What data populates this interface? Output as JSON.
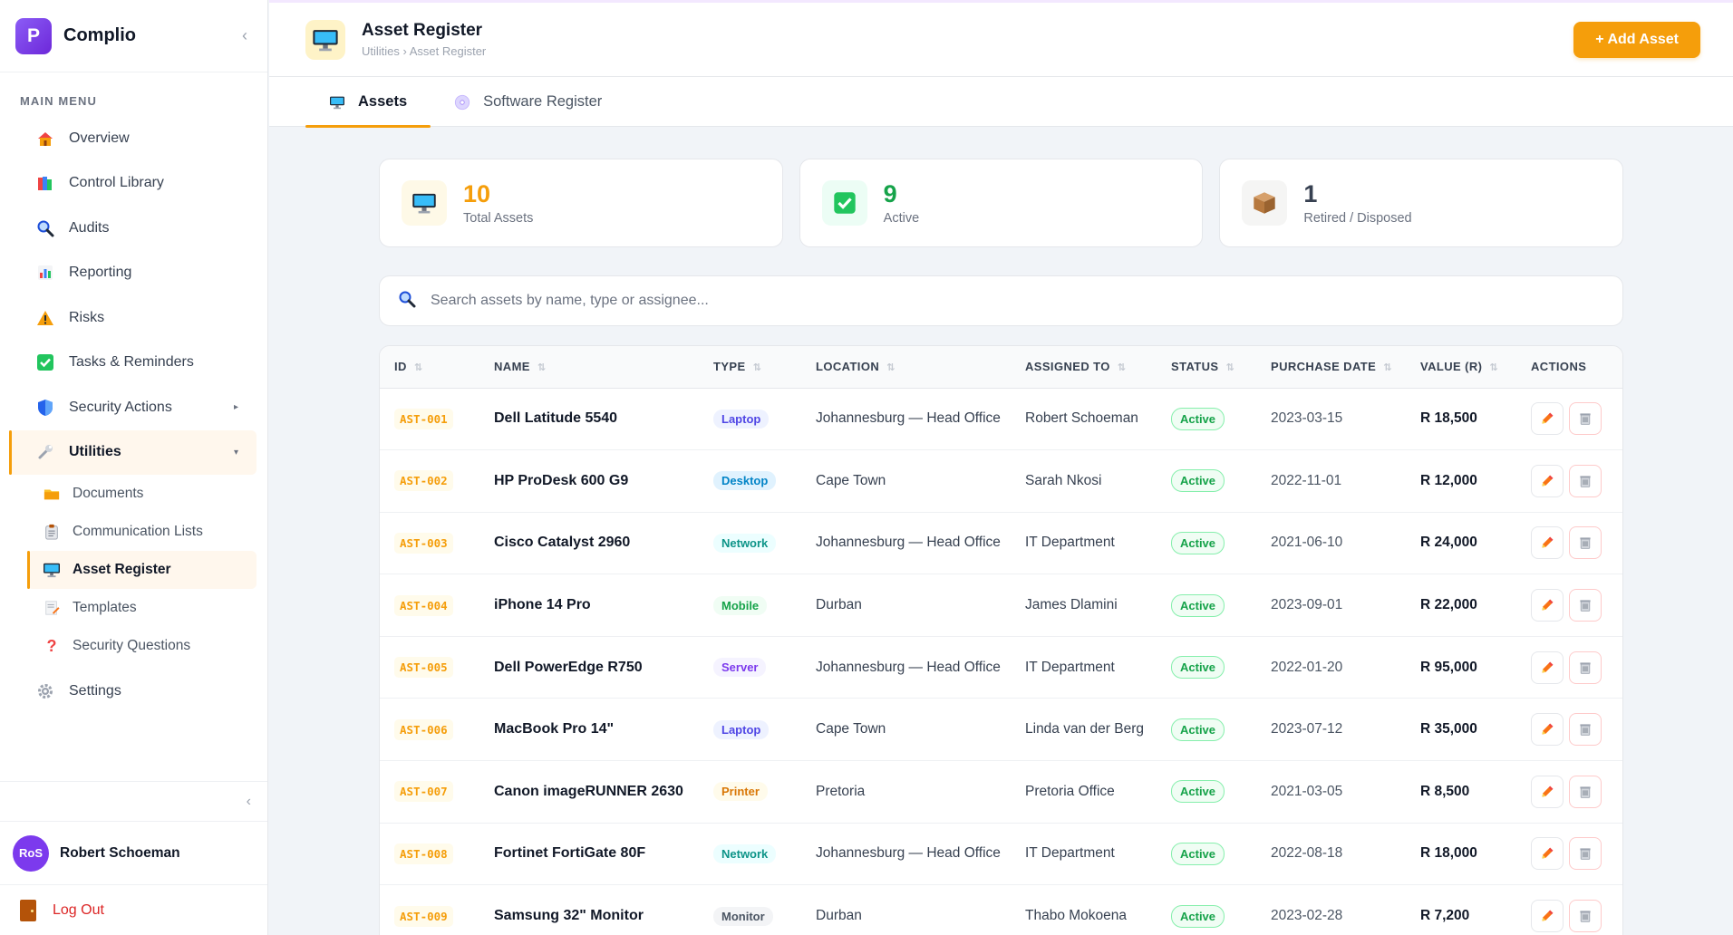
{
  "app": {
    "logo_letter": "P",
    "name": "Complio",
    "collapse_glyph": "‹"
  },
  "sidebar": {
    "menu_title": "MAIN MENU",
    "items": [
      {
        "label": "Overview",
        "icon": "house-icon"
      },
      {
        "label": "Control Library",
        "icon": "books-icon"
      },
      {
        "label": "Audits",
        "icon": "magnifier-icon"
      },
      {
        "label": "Reporting",
        "icon": "bar-chart-icon"
      },
      {
        "label": "Risks",
        "icon": "warning-icon"
      },
      {
        "label": "Tasks & Reminders",
        "icon": "checkbox-icon"
      },
      {
        "label": "Security Actions",
        "icon": "shield-icon",
        "caret": "▸"
      },
      {
        "label": "Utilities",
        "icon": "wrench-icon",
        "caret": "▾"
      }
    ],
    "sub_items": [
      {
        "label": "Documents",
        "icon": "folder-icon"
      },
      {
        "label": "Communication Lists",
        "icon": "clipboard-icon"
      },
      {
        "label": "Asset Register",
        "icon": "monitor-icon"
      },
      {
        "label": "Templates",
        "icon": "memo-icon"
      },
      {
        "label": "Security Questions",
        "icon": "question-icon"
      }
    ],
    "settings_label": "Settings",
    "collapse_glyph": "‹",
    "user": {
      "initials": "RoS",
      "name": "Robert Schoeman"
    },
    "logout_label": "Log Out"
  },
  "header": {
    "title": "Asset Register",
    "breadcrumb": "Utilities › Asset Register",
    "add_button": "+ Add Asset"
  },
  "tabs": [
    {
      "label": "Assets",
      "icon": "monitor-icon",
      "active": true
    },
    {
      "label": "Software Register",
      "icon": "disc-icon",
      "active": false
    }
  ],
  "stats": [
    {
      "value": "10",
      "label": "Total Assets",
      "color": "#f59e0b",
      "icon": "monitor-icon"
    },
    {
      "value": "9",
      "label": "Active",
      "color": "#16a34a",
      "icon": "checkbox-icon"
    },
    {
      "value": "1",
      "label": "Retired / Disposed",
      "color": "#374151",
      "icon": "box-icon"
    }
  ],
  "search": {
    "placeholder": "Search assets by name, type or assignee..."
  },
  "table": {
    "columns": [
      "ID",
      "NAME",
      "TYPE",
      "LOCATION",
      "ASSIGNED TO",
      "STATUS",
      "PURCHASE DATE",
      "VALUE (R)",
      "ACTIONS"
    ],
    "sort_glyph": "⇅",
    "rows": [
      {
        "id": "AST-001",
        "name": "Dell Latitude 5540",
        "type": "Laptop",
        "location": "Johannesburg — Head Office",
        "assigned": "Robert Schoeman",
        "status": "Active",
        "date": "2023-03-15",
        "value": "R 18,500"
      },
      {
        "id": "AST-002",
        "name": "HP ProDesk 600 G9",
        "type": "Desktop",
        "location": "Cape Town",
        "assigned": "Sarah Nkosi",
        "status": "Active",
        "date": "2022-11-01",
        "value": "R 12,000"
      },
      {
        "id": "AST-003",
        "name": "Cisco Catalyst 2960",
        "type": "Network",
        "location": "Johannesburg — Head Office",
        "assigned": "IT Department",
        "status": "Active",
        "date": "2021-06-10",
        "value": "R 24,000"
      },
      {
        "id": "AST-004",
        "name": "iPhone 14 Pro",
        "type": "Mobile",
        "location": "Durban",
        "assigned": "James Dlamini",
        "status": "Active",
        "date": "2023-09-01",
        "value": "R 22,000"
      },
      {
        "id": "AST-005",
        "name": "Dell PowerEdge R750",
        "type": "Server",
        "location": "Johannesburg — Head Office",
        "assigned": "IT Department",
        "status": "Active",
        "date": "2022-01-20",
        "value": "R 95,000"
      },
      {
        "id": "AST-006",
        "name": "MacBook Pro 14\"",
        "type": "Laptop",
        "location": "Cape Town",
        "assigned": "Linda van der Berg",
        "status": "Active",
        "date": "2023-07-12",
        "value": "R 35,000"
      },
      {
        "id": "AST-007",
        "name": "Canon imageRUNNER 2630",
        "type": "Printer",
        "location": "Pretoria",
        "assigned": "Pretoria Office",
        "status": "Active",
        "date": "2021-03-05",
        "value": "R 8,500"
      },
      {
        "id": "AST-008",
        "name": "Fortinet FortiGate 80F",
        "type": "Network",
        "location": "Johannesburg — Head Office",
        "assigned": "IT Department",
        "status": "Active",
        "date": "2022-08-18",
        "value": "R 18,000"
      },
      {
        "id": "AST-009",
        "name": "Samsung 32\" Monitor",
        "type": "Monitor",
        "location": "Durban",
        "assigned": "Thabo Mokoena",
        "status": "Active",
        "date": "2023-02-28",
        "value": "R 7,200"
      }
    ]
  },
  "type_colors": {
    "Laptop": {
      "fg": "#4f46e5",
      "bg": "#eef2ff"
    },
    "Desktop": {
      "fg": "#0284c7",
      "bg": "#e0f2fe"
    },
    "Network": {
      "fg": "#0d9488",
      "bg": "#ecfeff"
    },
    "Mobile": {
      "fg": "#16a34a",
      "bg": "#f0fdf4"
    },
    "Server": {
      "fg": "#7c3aed",
      "bg": "#f5f3ff"
    },
    "Printer": {
      "fg": "#d97706",
      "bg": "#fffbeb"
    },
    "Monitor": {
      "fg": "#4b5563",
      "bg": "#f3f4f6"
    }
  }
}
